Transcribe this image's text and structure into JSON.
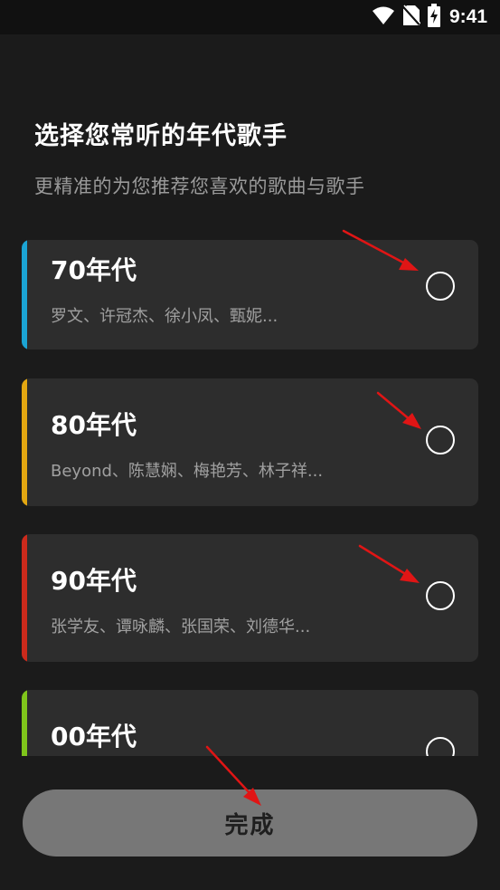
{
  "status_bar": {
    "time": "9:41",
    "icons": [
      "wifi-icon",
      "no-sim-icon",
      "battery-charging-icon"
    ]
  },
  "header": {
    "title": "选择您常听的年代歌手",
    "subtitle": "更精准的为您推荐您喜欢的歌曲与歌手"
  },
  "eras": [
    {
      "name": "70年代",
      "artists": "罗文、许冠杰、徐小凤、甄妮...",
      "accent_color": "#1ba4d4",
      "selected": false
    },
    {
      "name": "80年代",
      "artists": "Beyond、陈慧娴、梅艳芳、林子祥...",
      "accent_color": "#e3a711",
      "selected": false
    },
    {
      "name": "90年代",
      "artists": "张学友、谭咏麟、张国荣、刘德华...",
      "accent_color": "#cc2a1c",
      "selected": false
    },
    {
      "name": "00年代",
      "artists": "",
      "accent_color": "#7fc51b",
      "selected": false
    }
  ],
  "done_button": {
    "label": "完成"
  },
  "colors": {
    "background": "#1b1b1b",
    "card": "#2d2d2d",
    "button": "#777777",
    "annotation_arrow": "#e01515"
  }
}
